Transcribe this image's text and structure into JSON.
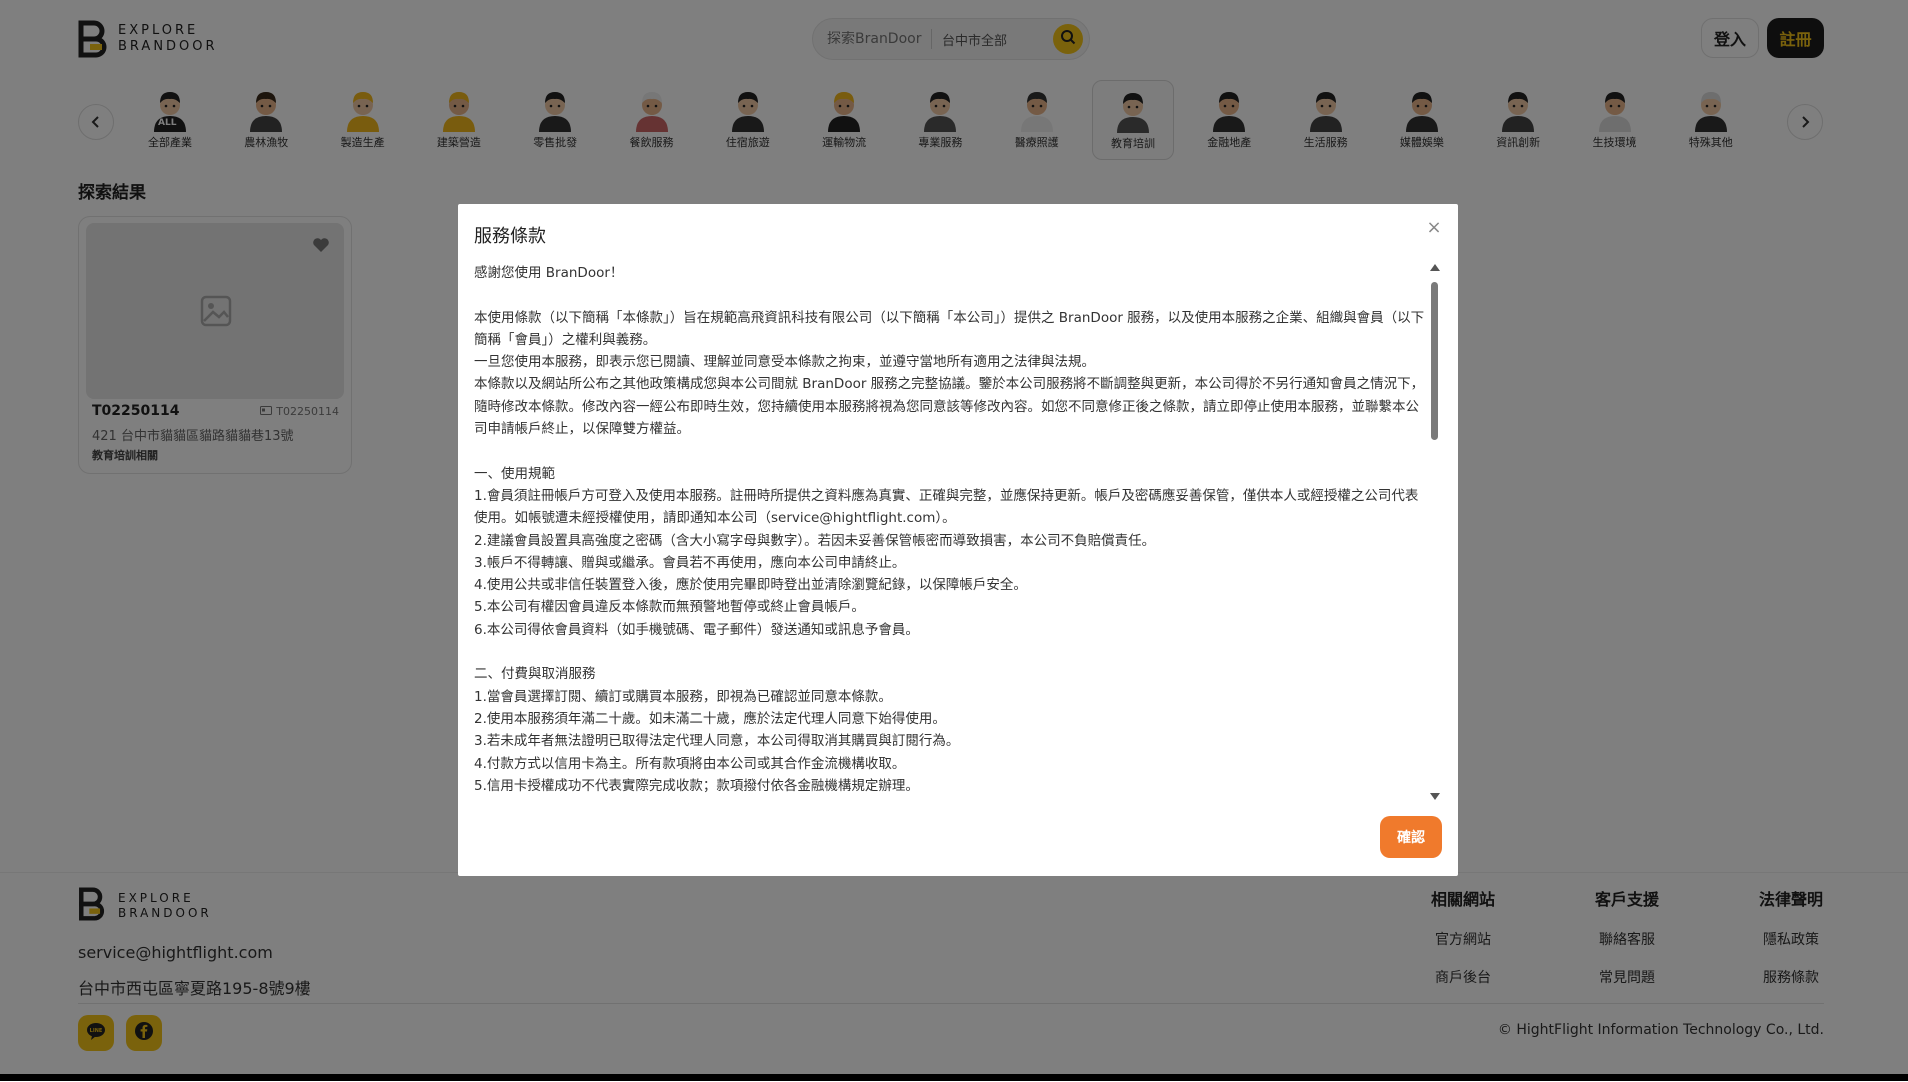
{
  "header": {
    "logo_line1": "EXPLORE",
    "logo_line2": "BRANDOOR",
    "search_placeholder": "探索BranDoor",
    "search_city": "台中市全部",
    "login_label": "登入",
    "signup_label": "註冊"
  },
  "categories": [
    {
      "label": "全部產業",
      "icon": "all-icon",
      "badge": "ALL"
    },
    {
      "label": "農林漁牧",
      "icon": "farmer-icon"
    },
    {
      "label": "製造生產",
      "icon": "manufacturing-icon"
    },
    {
      "label": "建築營造",
      "icon": "construction-icon"
    },
    {
      "label": "零售批發",
      "icon": "retail-icon"
    },
    {
      "label": "餐飲服務",
      "icon": "chef-icon"
    },
    {
      "label": "住宿旅遊",
      "icon": "hotel-icon"
    },
    {
      "label": "運輸物流",
      "icon": "delivery-icon"
    },
    {
      "label": "專業服務",
      "icon": "professional-icon"
    },
    {
      "label": "醫療照護",
      "icon": "doctor-icon"
    },
    {
      "label": "教育培訓",
      "icon": "teacher-icon",
      "active": true
    },
    {
      "label": "金融地產",
      "icon": "finance-icon"
    },
    {
      "label": "生活服務",
      "icon": "lifestyle-icon"
    },
    {
      "label": "媒體娛樂",
      "icon": "media-icon"
    },
    {
      "label": "資訊創新",
      "icon": "it-icon"
    },
    {
      "label": "生技環境",
      "icon": "biotech-icon"
    },
    {
      "label": "特殊其他",
      "icon": "other-icon"
    }
  ],
  "results": {
    "title": "探索結果",
    "card": {
      "name": "T02250114",
      "code": "T02250114",
      "address": "421 台中市貓貓區貓路貓貓巷13號",
      "tag": "教育培訓相關"
    }
  },
  "modal": {
    "title": "服務條款",
    "close": "×",
    "confirm_label": "確認",
    "paragraphs": [
      "感謝您使用 BranDoor！",
      "",
      "本使用條款（以下簡稱「本條款」）旨在規範高飛資訊科技有限公司（以下簡稱「本公司」）提供之 BranDoor 服務，以及使用本服務之企業、組織與會員（以下簡稱「會員」）之權利與義務。",
      "一旦您使用本服務，即表示您已閱讀、理解並同意受本條款之拘束，並遵守當地所有適用之法律與法規。",
      "本條款以及網站所公布之其他政策構成您與本公司間就 BranDoor 服務之完整協議。鑒於本公司服務將不斷調整與更新，本公司得於不另行通知會員之情況下，隨時修改本條款。修改內容一經公布即時生效，您持續使用本服務將視為您同意該等修改內容。如您不同意修正後之條款，請立即停止使用本服務，並聯繫本公司申請帳戶終止，以保障雙方權益。",
      "",
      "一、使用規範",
      "1.會員須註冊帳戶方可登入及使用本服務。註冊時所提供之資料應為真實、正確與完整，並應保持更新。帳戶及密碼應妥善保管，僅供本人或經授權之公司代表使用。如帳號遭未經授權使用，請即通知本公司（service@hightflight.com）。",
      "2.建議會員設置具高強度之密碼（含大小寫字母與數字）。若因未妥善保管帳密而導致損害，本公司不負賠償責任。",
      "3.帳戶不得轉讓、贈與或繼承。會員若不再使用，應向本公司申請終止。",
      "4.使用公共或非信任裝置登入後，應於使用完畢即時登出並清除瀏覽紀錄，以保障帳戶安全。",
      "5.本公司有權因會員違反本條款而無預警地暫停或終止會員帳戶。",
      "6.本公司得依會員資料（如手機號碼、電子郵件）發送通知或訊息予會員。",
      "",
      "二、付費與取消服務",
      "1.當會員選擇訂閱、續訂或購買本服務，即視為已確認並同意本條款。",
      "2.使用本服務須年滿二十歲。如未滿二十歲，應於法定代理人同意下始得使用。",
      "3.若未成年者無法證明已取得法定代理人同意，本公司得取消其購買與訂閱行為。",
      "4.付款方式以信用卡為主。所有款項將由本公司或其合作金流機構收取。",
      "5.信用卡授權成功不代表實際完成收款；款項撥付依各金融機構規定辦理。"
    ]
  },
  "footer": {
    "logo_line1": "EXPLORE",
    "logo_line2": "BRANDOOR",
    "email": "service@hightflight.com",
    "address": "台中市西屯區寧夏路195-8號9樓",
    "columns": [
      {
        "title": "相關網站",
        "links": [
          "官方網站",
          "商戶後台"
        ]
      },
      {
        "title": "客戶支援",
        "links": [
          "聯絡客服",
          "常見問題"
        ]
      },
      {
        "title": "法律聲明",
        "links": [
          "隱私政策",
          "服務條款"
        ]
      }
    ],
    "copyright": "© HightFlight Information Technology Co., Ltd."
  },
  "colors": {
    "accent": "#f5c518",
    "confirm": "#f07a2c",
    "dark": "#1d1d1d",
    "overlay": "rgba(0,0,0,0.5)"
  }
}
